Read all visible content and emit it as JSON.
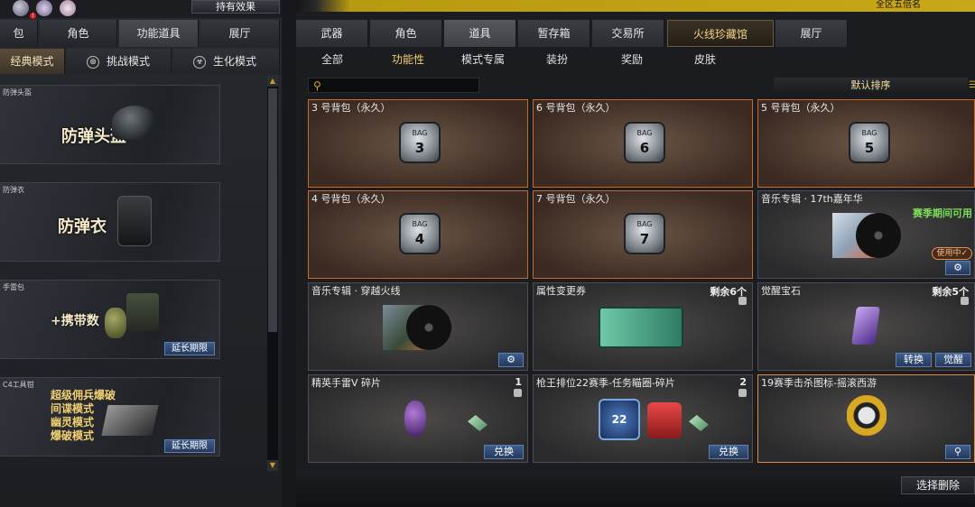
{
  "left": {
    "effect_button": "持有效果",
    "tabs": [
      "包",
      "角色",
      "功能道具",
      "展厅"
    ],
    "mode_tabs": [
      "经典模式",
      "挑战模式",
      "生化模式"
    ],
    "items": [
      {
        "name": "防弹头盔",
        "big": "防弹头盔",
        "button": ""
      },
      {
        "name": "防弹衣",
        "big": "防弹衣",
        "button": ""
      },
      {
        "name": "手雷包",
        "big": "+携带数",
        "button": "延长期限"
      },
      {
        "name": "C4工具钳",
        "lines": [
          "超级佣兵爆破",
          "间谍模式",
          "幽灵模式",
          "爆破模式"
        ],
        "button": "延长期限"
      }
    ]
  },
  "right": {
    "region": "全区五倍名",
    "tabs": [
      "武器",
      "角色",
      "道具",
      "暂存箱",
      "交易所",
      "火线珍藏馆",
      "展厅"
    ],
    "subtabs": [
      "全部",
      "功能性",
      "模式专属",
      "装扮",
      "奖励",
      "皮肤"
    ],
    "search_placeholder": "",
    "sort_label": "默认排序",
    "cards": [
      {
        "title": "3 号背包（永久）",
        "bag": "3"
      },
      {
        "title": "6 号背包（永久）",
        "bag": "6"
      },
      {
        "title": "5 号背包（永久）",
        "bag": "5"
      },
      {
        "title": "4 号背包（永久）",
        "bag": "4"
      },
      {
        "title": "7 号背包（永久）",
        "bag": "7"
      },
      {
        "title": "音乐专辑 · 17th嘉年华",
        "note": "赛季期间可用",
        "badge": "使用中✓"
      },
      {
        "title": "音乐专辑 · 穿越火线"
      },
      {
        "title": "属性变更券",
        "count": "剩余6个"
      },
      {
        "title": "觉醒宝石",
        "count": "剩余5个",
        "buttons": [
          "转换",
          "觉醒"
        ]
      },
      {
        "title": "精英手雷V 碎片",
        "count": "1",
        "button": "兑换"
      },
      {
        "title": "枪王排位22赛季-任务瞄圈-碎片",
        "count": "2",
        "button": "兑换",
        "sub": "22"
      },
      {
        "title": "19赛季击杀图标-摇滚西游"
      }
    ],
    "bag_label": "BAG",
    "delete_button": "选择删除"
  },
  "colors": {
    "accent": "#c8a718",
    "orange_border": "#c7682c",
    "button_blue": "#3d5d8c"
  }
}
